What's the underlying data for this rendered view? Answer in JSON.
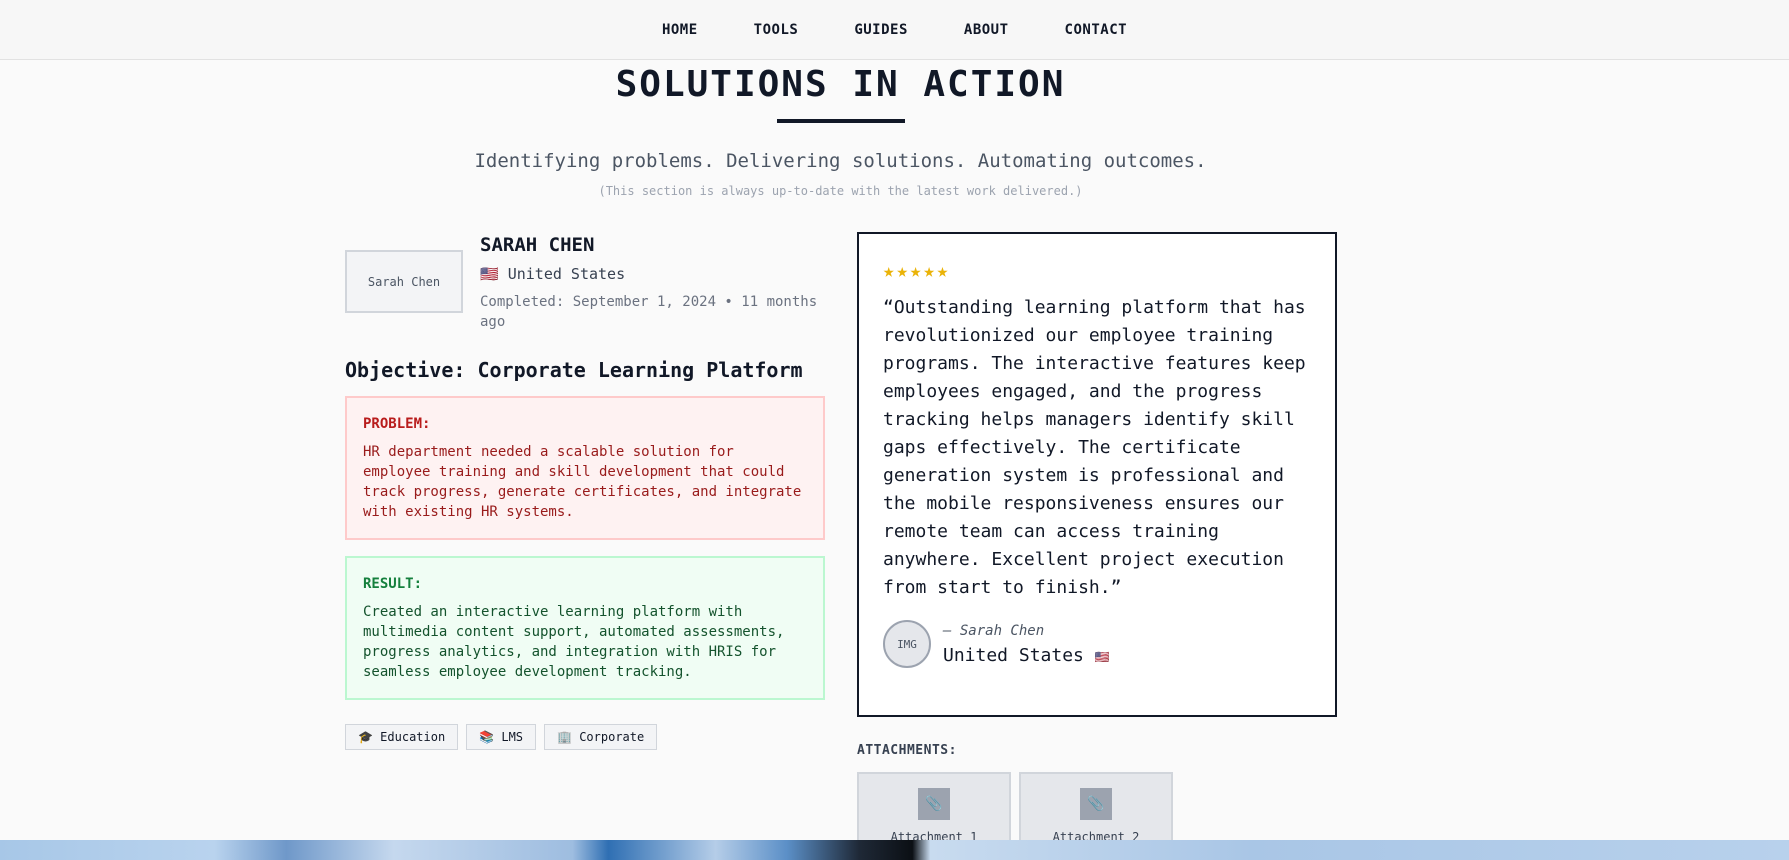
{
  "nav": {
    "items": [
      "HOME",
      "TOOLS",
      "GUIDES",
      "ABOUT",
      "CONTACT"
    ]
  },
  "hero": {
    "title": "SOLUTIONS IN ACTION",
    "subtitle": "Identifying problems. Delivering solutions. Automating outcomes.",
    "note": "(This section is always up-to-date with the latest work delivered.)"
  },
  "client": {
    "photo_alt": "Sarah Chen",
    "name": "SARAH CHEN",
    "flag": "🇺🇸",
    "country": "United States",
    "completed": "Completed: September 1, 2024 • 11 months ago"
  },
  "objective": "Objective: Corporate Learning Platform",
  "problem": {
    "label": "PROBLEM:",
    "text": "HR department needed a scalable solution for employee training and skill development that could track progress, generate certificates, and integrate with existing HR systems."
  },
  "result": {
    "label": "RESULT:",
    "text": "Created an interactive learning platform with multimedia content support, automated assessments, progress analytics, and integration with HRIS for seamless employee development tracking."
  },
  "tags": [
    "🎓 Education",
    "📚 LMS",
    "🏢 Corporate"
  ],
  "testimonial": {
    "stars": "★★★★★",
    "quote": "“Outstanding learning platform that has revolutionized our employee training programs. The interactive features keep employees engaged, and the progress tracking helps managers identify skill gaps effectively. The certificate generation system is professional and the mobile responsiveness ensures our remote team can access training anywhere. Excellent project execution from start to finish.”",
    "avatar_text": "IMG",
    "author": "— Sarah Chen",
    "country": "United States",
    "flag": "🇺🇸"
  },
  "attachments": {
    "label": "ATTACHMENTS:",
    "items": [
      "Attachment 1",
      "Attachment 2"
    ],
    "icon": "📎"
  }
}
